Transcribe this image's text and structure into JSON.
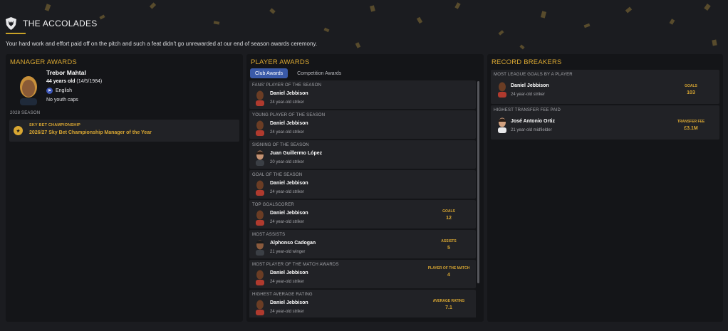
{
  "header": {
    "title": "THE ACCOLADES",
    "intro": "Your hard work and effort paid off on the pitch and such a feat didn't go unrewarded at our end of season awards ceremony.",
    "logo_icon": "wolf-crest-icon"
  },
  "colors": {
    "accent_gold": "#d9a732",
    "tab_active": "#3a5aa8",
    "panel_bg": "#141518",
    "card_bg": "#212226"
  },
  "manager_awards": {
    "title": "MANAGER AWARDS",
    "name": "Trebor Mahtal",
    "age": "44 years old",
    "dob": "(14/5/1984)",
    "nationality": "English",
    "caps": "No youth caps",
    "season": "2028 SEASON",
    "award": {
      "competition": "SKY BET CHAMPIONSHIP",
      "name": "2026/27 Sky Bet Championship Manager of the Year",
      "icon": "trophy-icon"
    }
  },
  "player_awards": {
    "title": "PLAYER AWARDS",
    "tabs": [
      "Club Awards",
      "Competition Awards"
    ],
    "active_tab": "Club Awards",
    "awards": [
      {
        "category": "FANS' PLAYER OF THE SEASON",
        "player": "Daniel Jebbison",
        "desc": "24 year-old striker",
        "stat_label": "",
        "stat_value": ""
      },
      {
        "category": "YOUNG PLAYER OF THE SEASON",
        "player": "Daniel Jebbison",
        "desc": "24 year-old striker",
        "stat_label": "",
        "stat_value": ""
      },
      {
        "category": "SIGNING OF THE SEASON",
        "player": "Juan Guillermo López",
        "desc": "20 year-old striker",
        "stat_label": "",
        "stat_value": ""
      },
      {
        "category": "GOAL OF THE SEASON",
        "player": "Daniel Jebbison",
        "desc": "24 year-old striker",
        "stat_label": "",
        "stat_value": ""
      },
      {
        "category": "TOP GOALSCORER",
        "player": "Daniel Jebbison",
        "desc": "24 year-old striker",
        "stat_label": "GOALS",
        "stat_value": "12"
      },
      {
        "category": "MOST ASSISTS",
        "player": "Alphonso Cadogan",
        "desc": "21 year-old winger",
        "stat_label": "ASSISTS",
        "stat_value": "5"
      },
      {
        "category": "MOST PLAYER OF THE MATCH AWARDS",
        "player": "Daniel Jebbison",
        "desc": "24 year-old striker",
        "stat_label": "PLAYER OF THE MATCH",
        "stat_value": "4"
      },
      {
        "category": "HIGHEST AVERAGE RATING",
        "player": "Daniel Jebbison",
        "desc": "24 year-old striker",
        "stat_label": "AVERAGE RATING",
        "stat_value": "7.1"
      }
    ]
  },
  "record_breakers": {
    "title": "RECORD BREAKERS",
    "records": [
      {
        "category": "MOST LEAGUE GOALS BY A PLAYER",
        "player": "Daniel Jebbison",
        "desc": "24 year-old striker",
        "stat_label": "GOALS",
        "stat_value": "103"
      },
      {
        "category": "HIGHEST TRANSFER FEE PAID",
        "player": "José Antonio Ortiz",
        "desc": "21 year-old midfielder",
        "stat_label": "TRANSFER FEE",
        "stat_value": "£3.1M"
      }
    ]
  }
}
